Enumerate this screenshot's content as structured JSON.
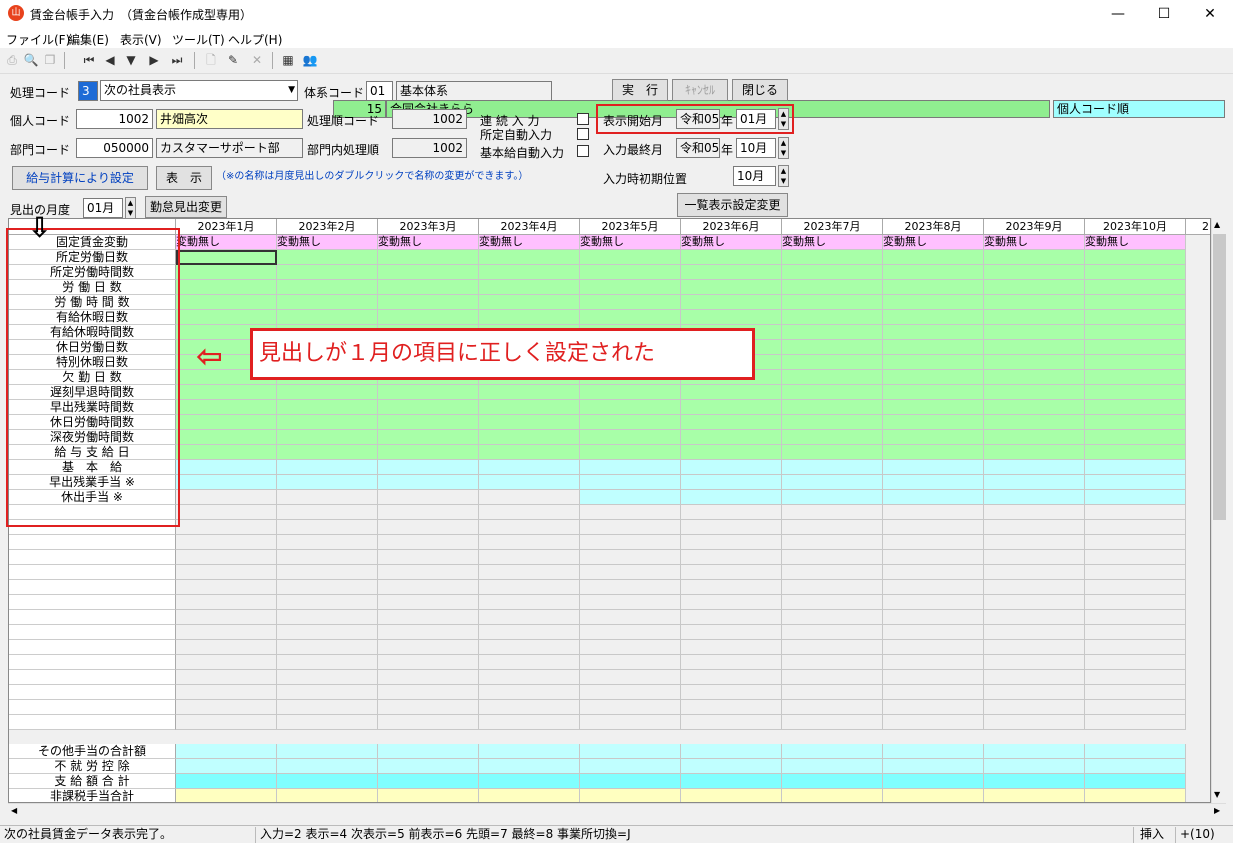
{
  "window": {
    "title": "賃金台帳手入力　（賃金台帳作成型専用）",
    "minimize": "—",
    "maximize": "☐",
    "close": "✕"
  },
  "menu": [
    "ファイル(F)",
    "編集(E)",
    "表示(V)",
    "ツール(T)",
    "ヘルプ(H)"
  ],
  "toolbar": {
    "company_no": "15",
    "company_name": "合同会社きらら",
    "sort_order": "個人コード順"
  },
  "form": {
    "shori_label": "処理コード",
    "shori_code": "3",
    "shori_value": "次の社員表示",
    "taikei_label": "体系コード",
    "taikei_code": "01",
    "taikei_name": "基本体系",
    "jikko": "実　行",
    "cancel": "ｷｬﾝｾﾙ",
    "close": "閉じる",
    "kojin_label": "個人コード",
    "kojin_code": "1002",
    "kojin_name": "井畑高次",
    "shorijun_label": "処理順コード",
    "shorijun_value": "1002",
    "renzoku": "連 続 入 力",
    "shotei_auto": "所定自動入力",
    "kihon_auto": "基本給自動入力",
    "bumon_label": "部門コード",
    "bumon_code": "050000",
    "bumon_name": "カスタマーサポート部",
    "bumonnai_label": "部門内処理順",
    "bumonnai_value": "1002",
    "start_label": "表示開始月",
    "start_era": "令和05",
    "start_nen": "年",
    "start_month": "01月",
    "last_label": "入力最終月",
    "last_era": "令和05",
    "last_nen": "年",
    "last_month": "10月",
    "initpos_label": "入力時初期位置",
    "initpos_value": "10月",
    "kyuyo_btn": "給与計算により設定",
    "hyoji_btn": "表　示",
    "note": "（※の名称は月度見出しのダブルクリックで名称の変更ができます。）",
    "midashi_label": "見出の月度",
    "midashi_value": "01月",
    "kintai_btn": "勤怠見出変更",
    "ichiran_btn": "一覧表示設定変更"
  },
  "grid": {
    "months": [
      "2023年1月",
      "2023年2月",
      "2023年3月",
      "2023年4月",
      "2023年5月",
      "2023年6月",
      "2023年7月",
      "2023年8月",
      "2023年9月",
      "2023年10月"
    ],
    "partial_header": "2",
    "rows": [
      {
        "label": "固定賃金変動",
        "color": "pink",
        "value": "変動無し"
      },
      {
        "label": "所定労働日数",
        "color": "green",
        "value": ""
      },
      {
        "label": "所定労働時間数",
        "color": "green",
        "value": ""
      },
      {
        "label": "労 働 日 数",
        "color": "green",
        "value": ""
      },
      {
        "label": "労 働 時 間 数",
        "color": "green",
        "value": ""
      },
      {
        "label": "有給休暇日数",
        "color": "green",
        "value": ""
      },
      {
        "label": "有給休暇時間数",
        "color": "green",
        "value": ""
      },
      {
        "label": "休日労働日数",
        "color": "green",
        "value": ""
      },
      {
        "label": "特別休暇日数",
        "color": "green",
        "value": ""
      },
      {
        "label": "欠 勤 日 数",
        "color": "green",
        "value": ""
      },
      {
        "label": "遅刻早退時間数",
        "color": "green",
        "value": ""
      },
      {
        "label": "早出残業時間数",
        "color": "green",
        "value": ""
      },
      {
        "label": "休日労働時間数",
        "color": "green",
        "value": ""
      },
      {
        "label": "深夜労働時間数",
        "color": "green",
        "value": ""
      },
      {
        "label": "給 与 支 給 日",
        "color": "green",
        "value": ""
      },
      {
        "label": "基　本　給",
        "color": "cy",
        "value": ""
      },
      {
        "label": "早出残業手当 ※",
        "color": "cy",
        "value": ""
      },
      {
        "label": "休出手当 ※",
        "color": "cy",
        "value": ""
      }
    ],
    "footer_rows": [
      {
        "label": "その他手当の合計額",
        "color": "cy"
      },
      {
        "label": "不 就 労 控 除",
        "color": "cy"
      },
      {
        "label": "支 給 額 合 計",
        "color": "cy2"
      },
      {
        "label": "非課税手当合計",
        "color": "yl"
      }
    ]
  },
  "annotation": "見出しが１月の項目に正しく設定された",
  "status": {
    "message": "次の社員賃金データ表示完了。",
    "keys": "入力=2 表示=4 次表示=5 前表示=6 先頭=7 最終=8 事業所切換=J",
    "mode": "挿入",
    "count": "+(10)"
  }
}
